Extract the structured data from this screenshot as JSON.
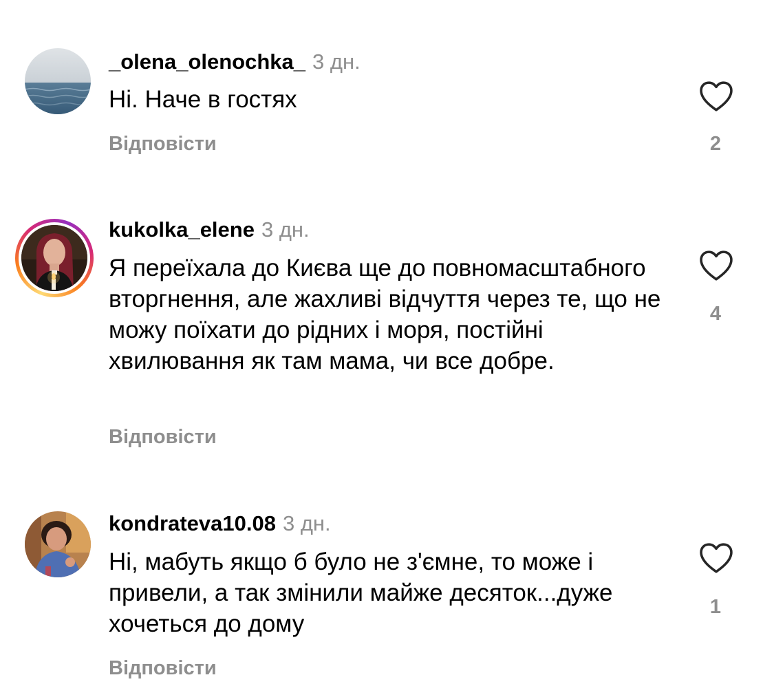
{
  "comments": [
    {
      "username": "_olena_olenochka_",
      "time": "3 дн.",
      "text": "Ні. Наче в гостях",
      "reply_label": "Відповісти",
      "likes": "2",
      "avatar": "sea-photo-avatar",
      "story_ring": false
    },
    {
      "username": "kukolka_elene",
      "time": "3 дн.",
      "text": "Я переїхала до Києва ще до повномасштабного вторгнення, але жахливі відчуття через те, що не можу поїхати до рідних і моря, постійні хвилювання як там мама, чи все добре.",
      "reply_label": "Відповісти",
      "likes": "4",
      "avatar": "woman-with-candle-avatar",
      "story_ring": true
    },
    {
      "username": "kondrateva10.08",
      "time": "3 дн.",
      "text": "Ні, мабуть якщо б було не з'ємне, то може і привели, а так змінили майже десяток...дуже хочеться до дому",
      "reply_label": "Відповісти",
      "likes": "1",
      "avatar": "woman-portrait-avatar",
      "story_ring": false
    }
  ],
  "colors": {
    "secondary_text": "#8e8e8e",
    "primary_text": "#000000",
    "heart_outline": "#262626"
  },
  "icons": {
    "like": "heart-outline-icon"
  }
}
